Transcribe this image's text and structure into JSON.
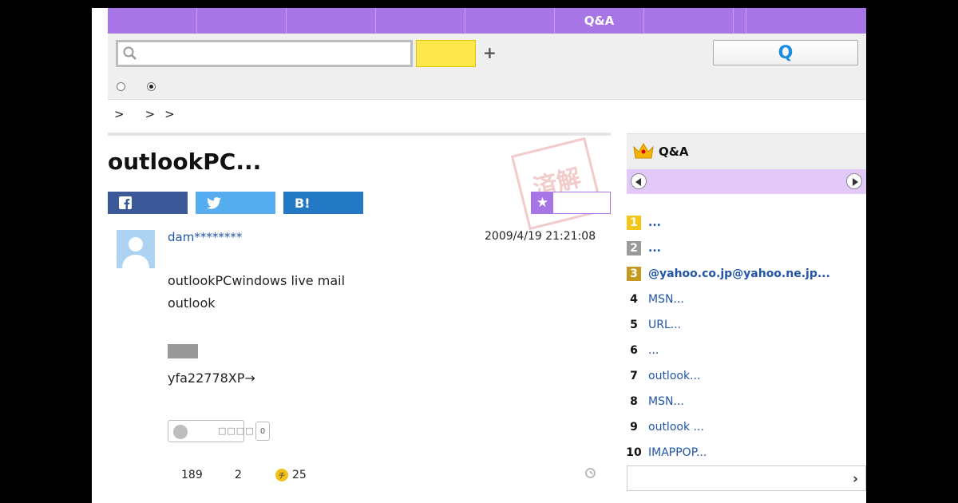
{
  "nav": {
    "tabs": [
      "",
      "",
      "",
      "",
      "",
      "Q&A",
      "",
      "",
      ""
    ]
  },
  "search": {
    "placeholder": "",
    "value": "",
    "plus_label": "+",
    "qa_button_label": "Q"
  },
  "breadcrumb": [
    ">",
    ">",
    ">"
  ],
  "question": {
    "title": "outlookPC...",
    "stamp_text": "済解決",
    "user": "dam********",
    "date": "2009/4/19  21:21:08",
    "body_lines": [
      "outlookPCwindows live mail",
      "outlook",
      "yfa22778XP→"
    ],
    "reaction_label": "□□□□",
    "reaction_count": "0",
    "views": "189",
    "answers": "2",
    "coins": "25"
  },
  "share": {
    "facebook_icon": "facebook-icon",
    "twitter_icon": "twitter-icon",
    "hatena_label": "B!"
  },
  "sidebar": {
    "title": "Q&A",
    "ranking": [
      {
        "rank": "1",
        "text": "   ...",
        "bold": true
      },
      {
        "rank": "2",
        "text": "...",
        "bold": true
      },
      {
        "rank": "3",
        "text": "@yahoo.co.jp@yahoo.ne.jp...",
        "bold": true
      },
      {
        "rank": "4",
        "text": "MSN...",
        "bold": false
      },
      {
        "rank": "5",
        "text": "URL...",
        "bold": false
      },
      {
        "rank": "6",
        "text": "   ...",
        "bold": false
      },
      {
        "rank": "7",
        "text": "outlook...",
        "bold": false
      },
      {
        "rank": "8",
        "text": "MSN...",
        "bold": false
      },
      {
        "rank": "9",
        "text": "outlook ...",
        "bold": false
      },
      {
        "rank": "10",
        "text": "IMAPPOP...",
        "bold": false
      }
    ],
    "more_chevron": "›"
  },
  "colors": {
    "nav_purple": "#a875e6",
    "nav_light_purple": "#e2c9fa",
    "search_yellow": "#fde74c",
    "facebook": "#3b5998",
    "twitter": "#55acee",
    "hatena": "#2479c4",
    "link_blue": "#2255aa"
  }
}
